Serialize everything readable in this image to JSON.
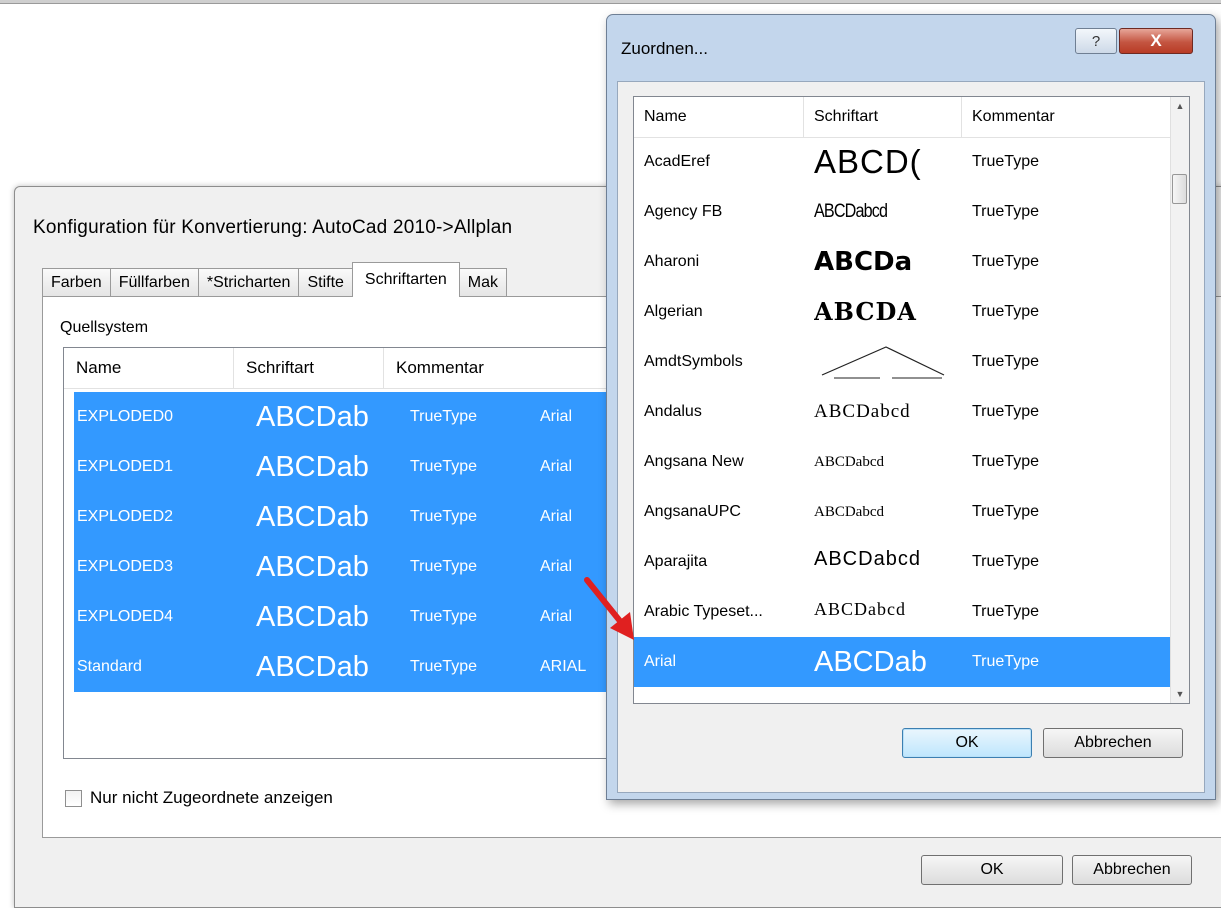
{
  "main_dialog": {
    "title": "Konfiguration für Konvertierung:  AutoCad 2010->Allplan",
    "tabs": [
      {
        "label": "Farben"
      },
      {
        "label": "Füllfarben"
      },
      {
        "label": "*Stricharten"
      },
      {
        "label": "Stifte"
      },
      {
        "label": "Schriftarten"
      },
      {
        "label": "Mak"
      }
    ],
    "active_tab": "Schriftarten",
    "source_label": "Quellsystem",
    "columns": [
      "Name",
      "Schriftart",
      "Kommentar"
    ],
    "rows": [
      {
        "name": "EXPLODED0",
        "preview": "ABCDab",
        "comment": "TrueType",
        "target": "Arial"
      },
      {
        "name": "EXPLODED1",
        "preview": "ABCDab",
        "comment": "TrueType",
        "target": "Arial"
      },
      {
        "name": "EXPLODED2",
        "preview": "ABCDab",
        "comment": "TrueType",
        "target": "Arial"
      },
      {
        "name": "EXPLODED3",
        "preview": "ABCDab",
        "comment": "TrueType",
        "target": "Arial"
      },
      {
        "name": "EXPLODED4",
        "preview": "ABCDab",
        "comment": "TrueType",
        "target": "Arial"
      },
      {
        "name": "Standard",
        "preview": "ABCDab",
        "comment": "TrueType",
        "target": "ARIAL"
      }
    ],
    "checkbox_label": "Nur nicht Zugeordnete anzeigen",
    "checkbox_checked": false,
    "ok_label": "OK",
    "cancel_label": "Abbrechen"
  },
  "assign_dialog": {
    "title": "Zuordnen...",
    "help_label": "?",
    "close_label": "X",
    "columns": [
      "Name",
      "Schriftart",
      "Kommentar"
    ],
    "rows": [
      {
        "name": "AcadEref",
        "preview": "ABCD(",
        "comment": "TrueType"
      },
      {
        "name": "Agency FB",
        "preview": "ABCDabcd",
        "comment": "TrueType"
      },
      {
        "name": "Aharoni",
        "preview": "ABCDa",
        "comment": "TrueType"
      },
      {
        "name": "Algerian",
        "preview": "ABCDA",
        "comment": "TrueType"
      },
      {
        "name": "AmdtSymbols",
        "preview": "",
        "comment": "TrueType"
      },
      {
        "name": "Andalus",
        "preview": "ABCDabcd",
        "comment": "TrueType"
      },
      {
        "name": "Angsana New",
        "preview": "ABCDabcd",
        "comment": "TrueType"
      },
      {
        "name": "AngsanaUPC",
        "preview": "ABCDabcd",
        "comment": "TrueType"
      },
      {
        "name": "Aparajita",
        "preview": "ABCDabcd",
        "comment": "TrueType"
      },
      {
        "name": "Arabic Typeset...",
        "preview": "ABCDabcd",
        "comment": "TrueType"
      },
      {
        "name": "Arial",
        "preview": "ABCDab",
        "comment": "TrueType",
        "selected": true
      }
    ],
    "ok_label": "OK",
    "cancel_label": "Abbrechen"
  },
  "colors": {
    "selection": "#3399ff",
    "arrow": "#e02020",
    "dialog_frame": "#c3d6ec"
  }
}
